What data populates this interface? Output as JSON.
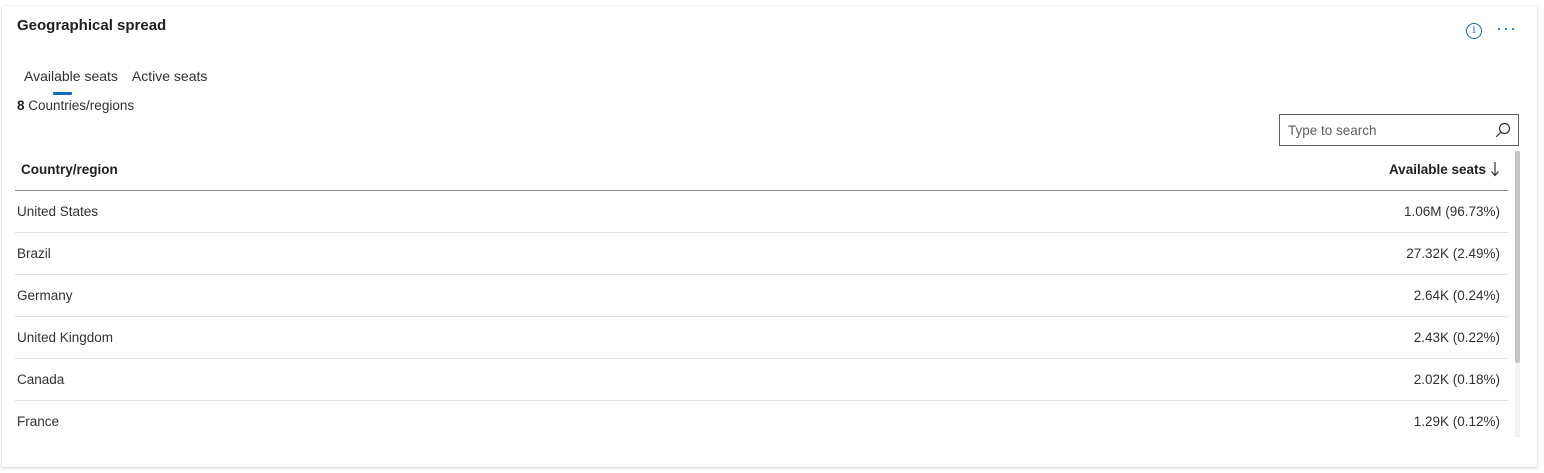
{
  "card": {
    "title": "Geographical spread",
    "info_icon": "info-icon",
    "more_icon": "more-options-icon",
    "more_glyph": "···"
  },
  "tabs": [
    {
      "label": "Available seats",
      "selected": true
    },
    {
      "label": "Active seats",
      "selected": false
    }
  ],
  "summary": {
    "count": "8",
    "label": "Countries/regions"
  },
  "search": {
    "placeholder": "Type to search",
    "value": ""
  },
  "table": {
    "columns": [
      "Country/region",
      "Available seats"
    ],
    "sort": {
      "column": "Available seats",
      "direction": "descending"
    },
    "rows": [
      {
        "country": "United States",
        "seats": "1.06M (96.73%)"
      },
      {
        "country": "Brazil",
        "seats": "27.32K (2.49%)"
      },
      {
        "country": "Germany",
        "seats": "2.64K (0.24%)"
      },
      {
        "country": "United Kingdom",
        "seats": "2.43K (0.22%)"
      },
      {
        "country": "Canada",
        "seats": "2.02K (0.18%)"
      },
      {
        "country": "France",
        "seats": "1.29K (0.12%)"
      }
    ]
  },
  "colors": {
    "accent": "#0f6cbd",
    "text": "#323130",
    "border": "#e1dfdd"
  }
}
